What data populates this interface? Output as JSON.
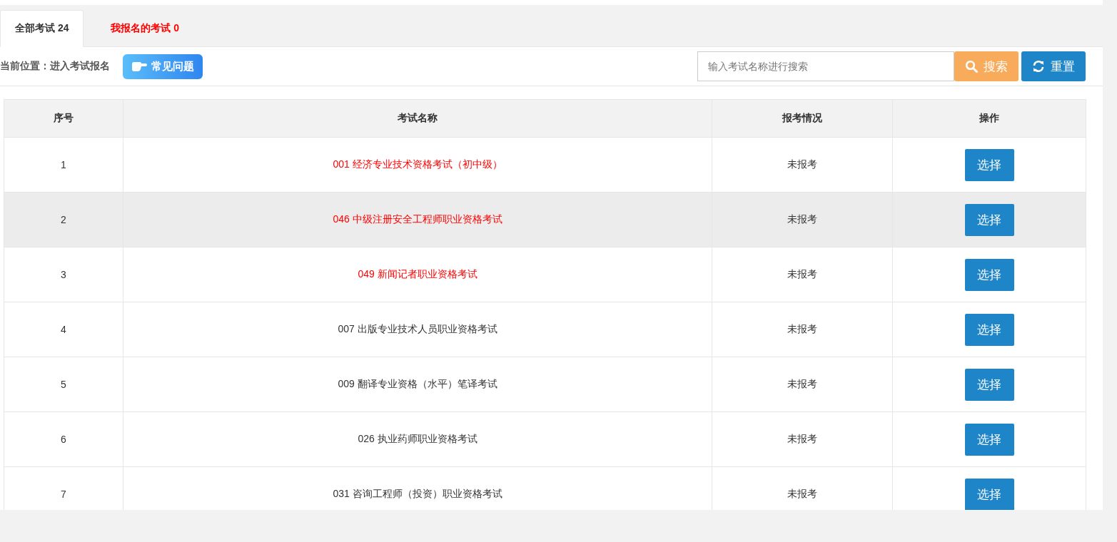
{
  "tabs": [
    {
      "label": "全部考试 24",
      "selected": true
    },
    {
      "label": "我报名的考试 0",
      "selected": false
    }
  ],
  "breadcrumb": "当前位置：进入考试报名",
  "faq_button": "常见问题",
  "search": {
    "placeholder": "输入考试名称进行搜索"
  },
  "buttons": [
    {
      "kind": "search",
      "label": "搜索"
    },
    {
      "kind": "reset",
      "label": "重置"
    }
  ],
  "table": {
    "columns": [
      "序号",
      "考试名称",
      "报考情况",
      "操作"
    ],
    "rows": [
      {
        "index": "1",
        "name": "001 经济专业技术资格考试（初中级）",
        "highlighted": true,
        "selected": false,
        "status": "未报考",
        "action": "选择"
      },
      {
        "index": "2",
        "name": "046 中级注册安全工程师职业资格考试",
        "highlighted": true,
        "selected": true,
        "status": "未报考",
        "action": "选择"
      },
      {
        "index": "3",
        "name": "049 新闻记者职业资格考试",
        "highlighted": true,
        "selected": false,
        "status": "未报考",
        "action": "选择"
      },
      {
        "index": "4",
        "name": "007 出版专业技术人员职业资格考试",
        "highlighted": false,
        "selected": false,
        "status": "未报考",
        "action": "选择"
      },
      {
        "index": "5",
        "name": "009 翻译专业资格（水平）笔译考试",
        "highlighted": false,
        "selected": false,
        "status": "未报考",
        "action": "选择"
      },
      {
        "index": "6",
        "name": "026 执业药师职业资格考试",
        "highlighted": false,
        "selected": false,
        "status": "未报考",
        "action": "选择"
      },
      {
        "index": "7",
        "name": "031 咨询工程师（投资）职业资格考试",
        "highlighted": false,
        "selected": false,
        "status": "未报考",
        "action": "选择"
      }
    ]
  }
}
